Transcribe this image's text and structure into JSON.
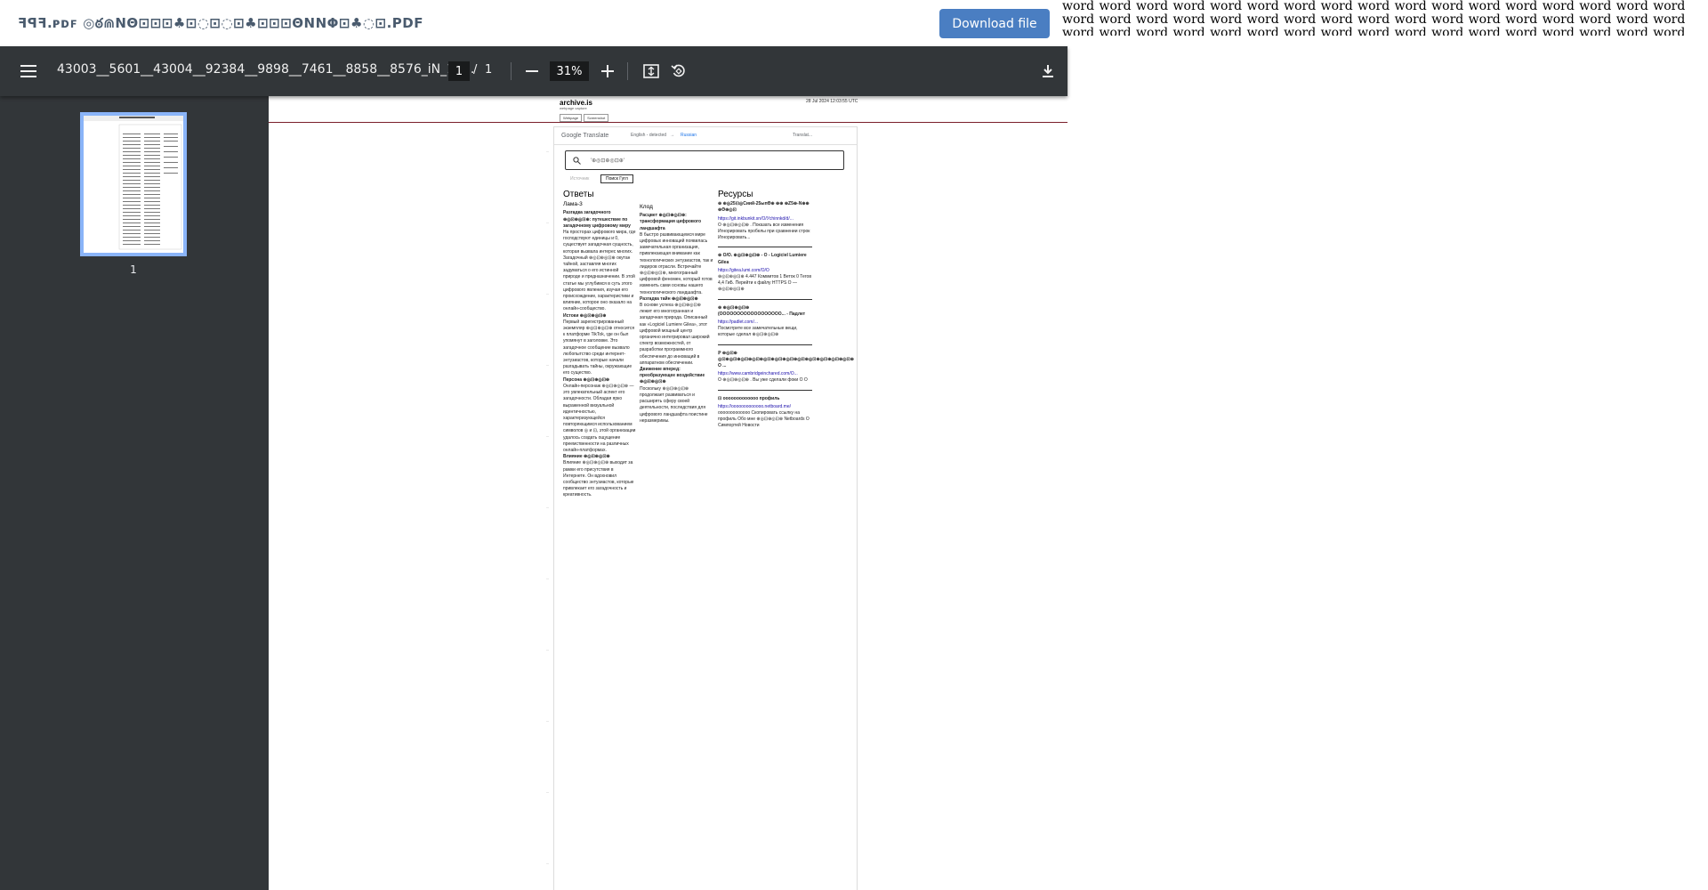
{
  "window": {
    "file_title": "ꟻꟼꟻ.ᴘᴅꜰ ◎ఠ⋒ΝΘ⊡⊡⊡♣⊡◌⊡◌⊡♣⊡⊡⊡ΘΝΝΦ⊡♣◌⊡.PDF",
    "download_label": "Download file",
    "word_filler": "word word word word word word word word word word word word word word word word word word word word word word word word word word word word word word word word word word word word word word word word word word word word word word word word word word word word word word word word word word word word word"
  },
  "toolbar": {
    "menu_icon": "hamburger-menu-icon",
    "doc_name": "43003__5601__43004__92384__9898__7461__8858__8576_iN_11...",
    "current_page": "1",
    "page_separator": "/",
    "total_pages": "1",
    "zoom_out_icon": "minus-icon",
    "zoom_value": "31%",
    "zoom_in_icon": "plus-icon",
    "fit_icon": "fit-to-page-icon",
    "rotate_icon": "rotate-icon",
    "download_icon": "download-icon"
  },
  "sidebar": {
    "thumbnail_label": "1"
  },
  "archive": {
    "logo": "archive.is",
    "subtitle": "webpage capture",
    "date": "28 Jul 2024 12:03:55 UTC",
    "tabs": [
      "Webpage",
      "Screenshot"
    ]
  },
  "google_translate": {
    "logo": "Google Translate",
    "source_lang": "English - detected",
    "arrow": "→",
    "target_lang": "Russian",
    "translate_btn": "Translat...",
    "search_text": "'⊕◎⊡⊕◎⊡⊕'",
    "chip_1": "Источник",
    "chip_2": "Поиск Гугл",
    "col_answers": {
      "heading": "Ответы",
      "sub": "Лама-3",
      "title": "Разгадка загадочного ⊕◎⊡⊕◎⊡⊕: путешествие по загадочному цифровому миру",
      "text": "На просторах цифрового мира, где господствуют единицы и 0, существует загадочная сущность, которая вызвала интерес многих. Загадочный ⊕◎⊡⊕◎⊡⊕ окутан тайной, заставляя многих задуматься о его истинной природе и предназначении. В этой статье мы углубимся в суть этого цифрового явления, изучая его происхождение, характеристики и влияние, которое оно оказало на онлайн-сообщество.",
      "sec1": "Истоки ⊕◎⊡⊕◎⊡⊕",
      "sec1_text": "Первый зарегистрированный экземпляр ⊕◎⊡⊕◎⊡⊕ относится к платформе TikTok, где он был упомянут в заголовке. Это загадочное сообщение вызвало любопытство среди интернет-энтузиастов, которые начали разгадывать тайны, окружающие его существо.",
      "sec2": "Персона ⊕◎⊡⊕◎⊡⊕",
      "sec2_text": "Онлайн-персонаж ⊕◎⊡⊕◎⊡⊕ — это увлекательный аспект его загадочности. Обладая ярко выраженной визуальной идентичностью, характеризующейся повторяющимся использованием символов ◎ и ⊡, этой организации удалось создать ощущение преемственности на различных онлайн-платформах.",
      "sec3": "Влияние ⊕◎⊡⊕◎⊡⊕",
      "sec3_text": "Влияние ⊕◎⊡⊕◎⊡⊕ выходит за рамки его присутствия в Интернете. Он вдохновил сообщество энтузиастов, которые привлекает его загадочность и креативность."
    },
    "col_claude": {
      "sub": "Клод",
      "title": "Расцвет ⊕◎⊡⊕◎⊡⊕: трансформация цифрового ландшафта",
      "text": "В быстро развивающемся мире цифровых инноваций появилась замечательная организация, привлекающая внимание как технологических энтузиастов, так и лидеров отрасли. Встречайте ⊕◎⊡⊕◎⊡⊕, многогранный цифровой феномен, который готов изменить сами основы нашего технологического ландшафта.",
      "sec1": "Разгадка тайн ⊕◎⊡⊕◎⊡⊕",
      "sec1_text": "В основе успеха ⊕◎⊡⊕◎⊡⊕ лежит его многогранная и загадочная природа. Описанный как «Logiciel Lumiere Gilea», этот цифровой мощный центр органично интегрировал широкий спектр возможностей, от разработки программного обеспечения до инноваций в аппаратном обеспечении.",
      "sec2": "Движение вперед: преобразующее воздействие ⊕◎⊡⊕◎⊡⊕",
      "sec2_text": "Поскольку ⊕◎⊡⊕◎⊡⊕ продолжает развиваться и расширять сферу своей деятельности, последствия для цифрового ландшафта поистине неразмеримы."
    },
    "col_resources": {
      "heading": "Ресурсы",
      "items": [
        {
          "title": "⊕ ⊕◎25⊡◎Сиий-25ыпӨ⊕ ⊕⊕ ⊕Ζ5⊕-Ν⊕⊕ ⊕Θ⊕◎⊡",
          "link": "https://git.inkbunkit.sn/O/Уchinnkd/d/...",
          "text": "О ⊕◎⊡⊕◎⊡⊕ . Показать все изменения Игнорировать пробелы при сравнении строк Игнорировать..."
        },
        {
          "title": "⊕ О/О. ⊕◎⊡⊕◎⊡⊕ - О - Logiciel Lumiere Gilea",
          "link": "https://gitea.lumi.com/О/О",
          "text": "⊕◎⊡⊕◎⊡⊕ 4.447 Коммитов 1 Веток 0 Тегов 4,4 ГиБ. Перейти к файлу HTTPS О — ⊕◎⊡⊕◎⊡⊕"
        },
        {
          "title": "⊕ ⊕◎⊡⊕◎⊡⊕ (ОООООООООООООООООО... - Падлет",
          "link": "https://padlet.com/...",
          "text": "Посмотрите все замечательные вещи, которые сделал ⊕◎⊡⊕◎⊡⊕"
        },
        {
          "title": "ℙ ⊕◎⊡⊕ ◎⊡⊕◎⊡⊕◎⊡⊕◎⊡⊕◎⊡⊕◎⊡⊕◎⊡⊕◎⊡⊕◎⊡⊕◎⊡⊕◎⊡⊕◎⊡⊕ О ...",
          "link": "https://www.cambridgeinchared.com/О...",
          "text": "О ⊕◎⊡⊕◎⊡⊕ . Вы уже сделали фоки О О"
        },
        {
          "title": "⊡ ооооооооооооо профиль",
          "link": "https://ооооооооооооо.netboard.me/",
          "text": "ооооооооооооо Скопировать ссылку на профиль Обо мне ⊕◎⊡⊕◎⊡⊕ Netboards О Симпортей Новости"
        }
      ]
    }
  }
}
